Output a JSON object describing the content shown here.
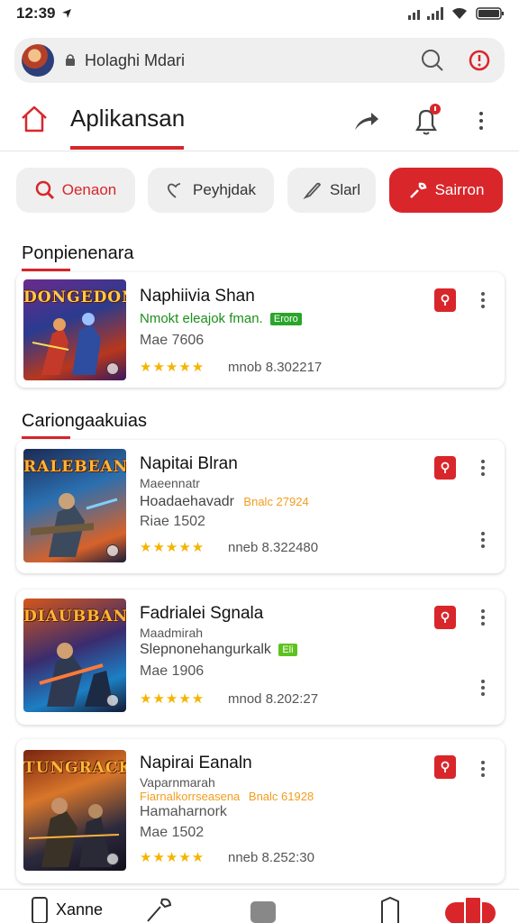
{
  "status": {
    "time": "12:39"
  },
  "search": {
    "text": "Holaghi Mdari"
  },
  "header": {
    "title": "Aplikansan"
  },
  "chips": [
    {
      "label": "Oenaon",
      "icon": "search-icon",
      "active": false
    },
    {
      "label": "Peyhjdak",
      "icon": "heart-icon",
      "active": false
    },
    {
      "label": "Slarl",
      "icon": "pen-icon",
      "active": false
    },
    {
      "label": "Sairron",
      "icon": "wrench-icon",
      "active": true
    }
  ],
  "sections": {
    "first": {
      "title": "Ponpienenara"
    },
    "second": {
      "title": "Cariongaakuias"
    }
  },
  "apps": [
    {
      "thumb_title": "DONGEDON",
      "name": "Naphiivia Shan",
      "line1": "Nmokt eleajok fman.",
      "line1_tag": "Eroro",
      "line2": "",
      "line2_tag": "",
      "meta": "Mae 7606",
      "stars": "★★★★★",
      "size": "mnob 8.302217"
    },
    {
      "thumb_title": "RALEBEAN",
      "name": "Napitai Blran",
      "line1": "Maeennatr",
      "line1_tag": "",
      "line2": "Hoadaehavadr",
      "line2_tag": "Bnalc 27924",
      "meta": "Riae 1502",
      "stars": "★★★★★",
      "size": "nneb 8.322480"
    },
    {
      "thumb_title": "DIAUBBAN",
      "name": "Fadrialei Sgnala",
      "line1": "Maadmirah",
      "line1_tag": "",
      "line2": "Slepnonehangurkalk",
      "line2_tag": "Eli",
      "meta": "Mae 1906",
      "stars": "★★★★★",
      "size": "mnod 8.202:27"
    },
    {
      "thumb_title": "TUNGRACK",
      "name": "Napirai Eanaln",
      "line1": "Vaparnmarah",
      "line1_tag": "",
      "line2": "Fiarnalkorrseasena",
      "line2_tag": "Bnalc 61928",
      "meta": "Hamaharnork",
      "meta2": "Mae 1502",
      "stars": "★★★★★",
      "size": "nneb 8.252:30"
    }
  ],
  "nav": {
    "first_label": "Xanne"
  },
  "colors": {
    "accent": "#d8262b",
    "star": "#f5b400",
    "tag_green": "#2aa52a",
    "tag_orange": "#f29d1d"
  }
}
